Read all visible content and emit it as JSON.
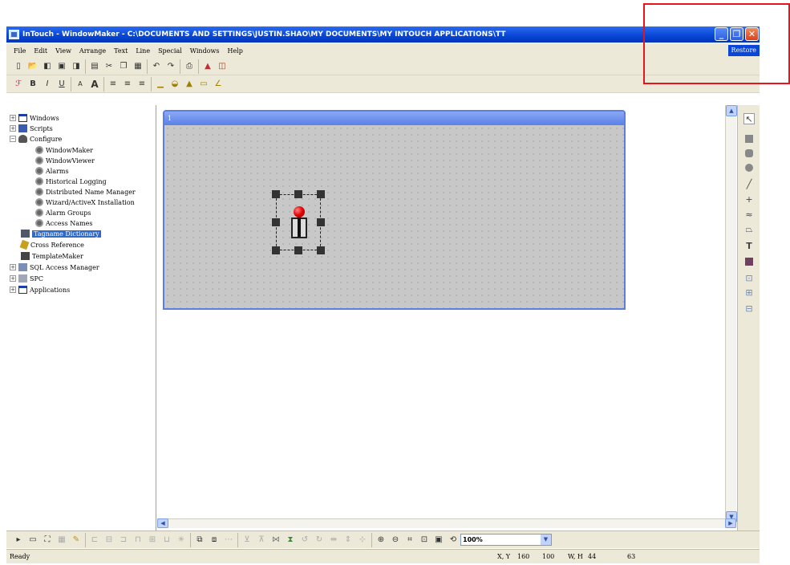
{
  "window": {
    "title": "InTouch - WindowMaker - C:\\DOCUMENTS AND SETTINGS\\JUSTIN.SHAO\\MY DOCUMENTS\\MY INTOUCH APPLICATIONS\\TT",
    "restore_tag": "Restore",
    "minimize_glyph": "_",
    "restore_glyph": "❐",
    "close_glyph": "✕"
  },
  "menu": {
    "items": [
      "File",
      "Edit",
      "View",
      "Arrange",
      "Text",
      "Line",
      "Special",
      "Windows",
      "Help"
    ]
  },
  "tree": {
    "items": [
      {
        "label": "Windows",
        "icon": "window-icon",
        "expander": "+"
      },
      {
        "label": "Scripts",
        "icon": "script-icon",
        "expander": "+"
      },
      {
        "label": "Configure",
        "icon": "configure-icon",
        "expander": "−"
      },
      {
        "label": "WindowMaker",
        "icon": "gear-icon"
      },
      {
        "label": "WindowViewer",
        "icon": "gear-icon"
      },
      {
        "label": "Alarms",
        "icon": "gear-icon"
      },
      {
        "label": "Historical Logging",
        "icon": "gear-icon"
      },
      {
        "label": "Distributed Name Manager",
        "icon": "gear-icon"
      },
      {
        "label": "Wizard/ActiveX Installation",
        "icon": "gear-icon"
      },
      {
        "label": "Alarm Groups",
        "icon": "gear-icon"
      },
      {
        "label": "Access Names",
        "icon": "gear-icon"
      },
      {
        "label": "Tagname Dictionary",
        "icon": "dictionary-icon",
        "selected": true
      },
      {
        "label": "Cross Reference",
        "icon": "cross-reference-icon"
      },
      {
        "label": "TemplateMaker",
        "icon": "template-icon"
      },
      {
        "label": "SQL Access Manager",
        "icon": "sql-icon",
        "expander": "+"
      },
      {
        "label": "SPC",
        "icon": "spc-icon",
        "expander": "+"
      },
      {
        "label": "Applications",
        "icon": "application-icon",
        "expander": "+"
      }
    ]
  },
  "child_window": {
    "title": "1"
  },
  "toolbar2": {
    "bold": "B",
    "italic": "I",
    "underline": "U",
    "text_a": "A",
    "text_big_a": "A"
  },
  "palette": {
    "text_tool": "T",
    "line_tool": "+"
  },
  "zoom": {
    "value": "100%"
  },
  "status": {
    "ready": "Ready",
    "xy_label": "X, Y",
    "x": "160",
    "y": "100",
    "wh_label": "W, H",
    "w": "44",
    "h": "63"
  },
  "colors": {
    "titlebar": "#0a47d8",
    "highlight": "#e8141c",
    "selection": "#316ac5"
  }
}
